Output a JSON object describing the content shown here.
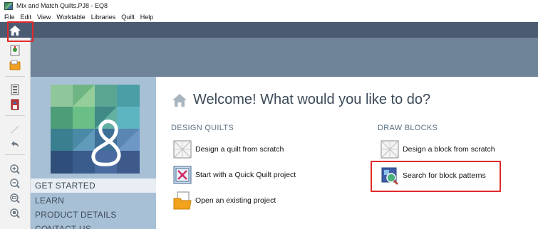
{
  "window": {
    "title": "Mix and Match Quilts.PJ8 - EQ8"
  },
  "menubar": {
    "items": [
      "File",
      "Edit",
      "View",
      "Worktable",
      "Libraries",
      "Quilt",
      "Help"
    ]
  },
  "toolbar": {
    "icons": [
      "home-icon",
      "new-project-icon",
      "open-folder-icon",
      "import-icon",
      "book-icon",
      "line-tool-icon",
      "undo-icon",
      "zoom-in-icon",
      "zoom-out-icon",
      "zoom-fit-icon",
      "zoom-actual-icon"
    ]
  },
  "leftpanel": {
    "nav": [
      "GET STARTED",
      "LEARN",
      "PRODUCT DETAILS",
      "CONTACT US"
    ],
    "active_index": 0
  },
  "main": {
    "welcome": "Welcome! What would you like to do?",
    "design_quilts": {
      "heading": "DESIGN QUILTS",
      "actions": [
        "Design a quilt from scratch",
        "Start with a Quick Quilt project",
        "Open an existing project"
      ]
    },
    "draw_blocks": {
      "heading": "DRAW BLOCKS",
      "actions": [
        "Design a block from scratch",
        "Search for block patterns"
      ]
    }
  },
  "colors": {
    "top_band": "#4b5b72",
    "mid_band": "#6f8399",
    "left_panel": "#a8c0d6",
    "highlight": "#e02a2a",
    "heading": "#5a6f83"
  }
}
